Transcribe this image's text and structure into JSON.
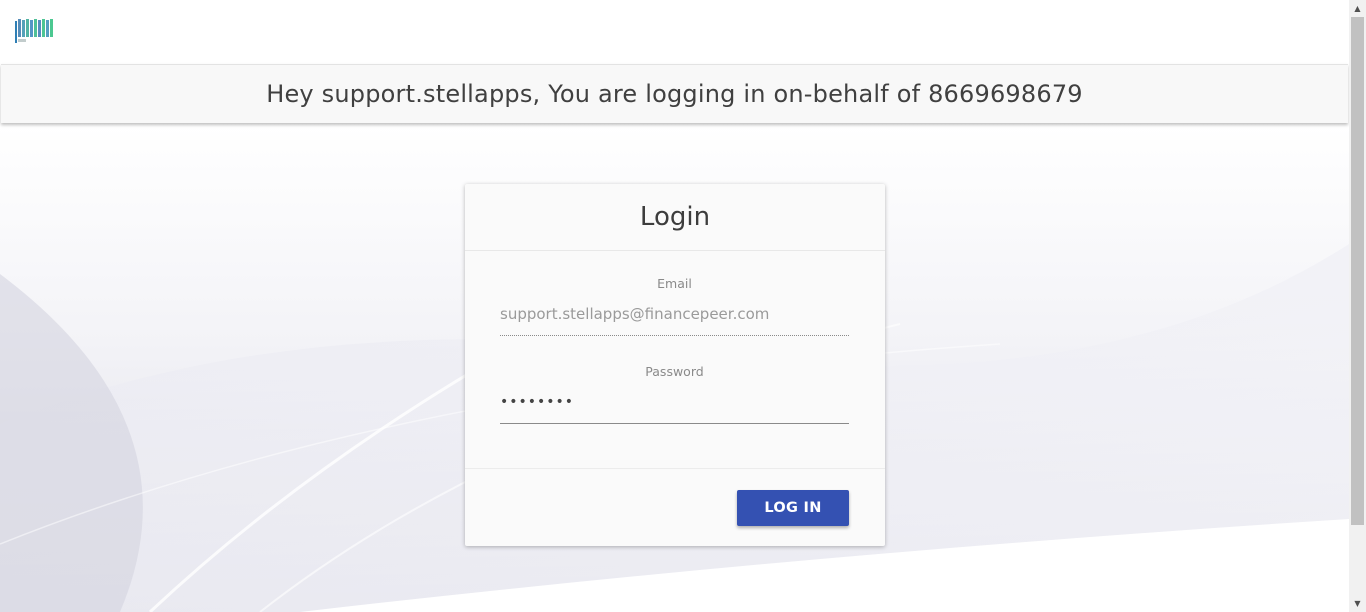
{
  "logo": {
    "icon": "financepeer-logo",
    "text": "FINANCEPEER"
  },
  "banner": {
    "message": "Hey support.stellapps, You are logging in on-behalf of 8669698679"
  },
  "login": {
    "title": "Login",
    "email_label": "Email",
    "email_value": "support.stellapps@financepeer.com",
    "password_label": "Password",
    "password_value": "••••••••",
    "submit_label": "LOG IN"
  },
  "colors": {
    "primary": "#3451b2",
    "banner_bg": "#f8f8f8"
  },
  "scrollbar": {
    "up_icon": "scroll-up-arrow-icon",
    "down_icon": "scroll-down-arrow-icon"
  }
}
